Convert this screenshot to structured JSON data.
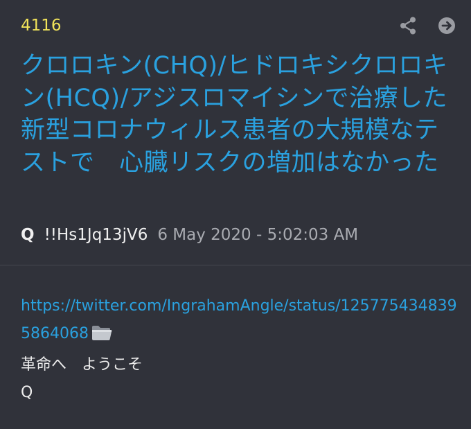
{
  "post": {
    "number": "4116",
    "title": "クロロキン(CHQ)/ヒドロキシクロロキン(HCQ)/アジスロマイシンで治療した　新型コロナウィルス患者の大規模なテストで　心臓リスクの増加はなかった",
    "author": "Q",
    "tripcode": "!!Hs1Jq13jV6",
    "timestamp": "6 May 2020 - 5:02:03 AM",
    "link": "https://twitter.com/IngrahamAngle/status/1257754348395864068",
    "lines": [
      "革命へ　ようこそ",
      "Q"
    ]
  },
  "icons": {
    "share": "share-icon",
    "next": "arrow-right-circle-icon",
    "attachment": "folder-icon"
  },
  "colors": {
    "background": "#30323a",
    "post_number": "#f2e45a",
    "title": "#2aa1df",
    "link": "#2aa1df",
    "text": "#ececec",
    "timestamp": "#a9abb1"
  }
}
